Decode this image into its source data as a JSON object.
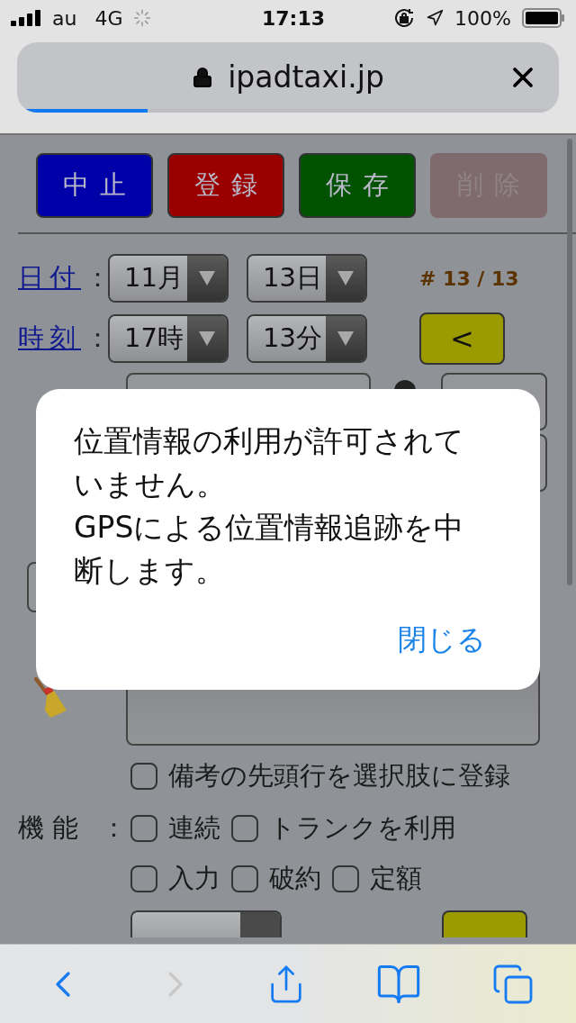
{
  "status_bar": {
    "carrier": "au",
    "network": "4G",
    "time": "17:13",
    "battery": "100%"
  },
  "address_bar": {
    "url": "ipadtaxi.jp",
    "level": 0.23
  },
  "action_buttons": [
    {
      "label": "中止",
      "color": "#0000a8",
      "disabled": false
    },
    {
      "label": "登録",
      "color": "#9b0000",
      "disabled": false
    },
    {
      "label": "保存",
      "color": "#005100",
      "disabled": false
    },
    {
      "label": "削除",
      "color": "#7f6a6e",
      "disabled": true
    }
  ],
  "date_row": {
    "label": "日付",
    "colon": "：",
    "selects": [
      "11月",
      "13日"
    ],
    "record": "# 13 / 13"
  },
  "time_row": {
    "label": "時刻",
    "colon": "：",
    "selects": [
      "17時",
      "13分"
    ],
    "nav_button": "<"
  },
  "first_line_option": {
    "label": "備考の先頭行を選択肢に登録",
    "checked": false
  },
  "features": {
    "label": "機 能",
    "colon": "：",
    "rows": [
      [
        {
          "label": "連続",
          "checked": false
        },
        {
          "label": "トランクを利用",
          "checked": false
        }
      ],
      [
        {
          "label": "入力",
          "checked": false
        },
        {
          "label": "破約",
          "checked": false
        },
        {
          "label": "定額",
          "checked": false
        }
      ]
    ]
  },
  "dialog": {
    "paragraphs": [
      "位置情報の利用が許可されていません。",
      "GPSによる位置情報追跡を中断します。"
    ],
    "button": "閉じる"
  },
  "toolbar": {
    "back_disabled": false,
    "forward_disabled": true
  }
}
